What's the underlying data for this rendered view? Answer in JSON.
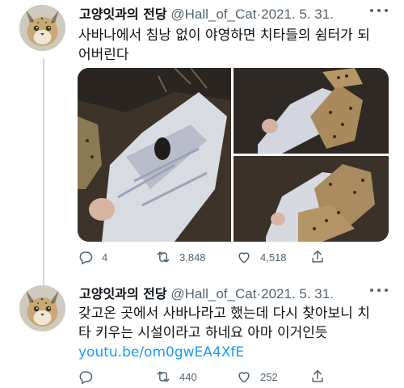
{
  "tweets": [
    {
      "author_name": "고양잇과의 전당",
      "handle": "@Hall_of_Cat",
      "separator": "·",
      "date": "2021. 5. 31.",
      "text_lines": [
        "사바나에서 침낭 없이 야영하면 치타들의 쉼터가 되",
        "어버린다"
      ],
      "actions": {
        "replies": "4",
        "retweets": "3,848",
        "likes": "4,518"
      }
    },
    {
      "author_name": "고양잇과의 전당",
      "handle": "@Hall_of_Cat",
      "separator": "·",
      "date": "2021. 5. 31.",
      "text_lines": [
        "갖고온 곳에서 사바나라고 했는데 다시 찾아보니 치",
        "타 키우는 시설이라고 하네요 아마 이거인듯"
      ],
      "link": "youtu.be/om0gwEA4XfE",
      "actions": {
        "replies": "",
        "retweets": "440",
        "likes": "252"
      }
    }
  ],
  "icons": [
    "more-icon",
    "reply-icon",
    "retweet-icon",
    "like-icon",
    "share-icon"
  ],
  "colors": {
    "link": "#1d9bf0",
    "secondary_text": "#536471",
    "thread_line": "#cfd9de"
  }
}
